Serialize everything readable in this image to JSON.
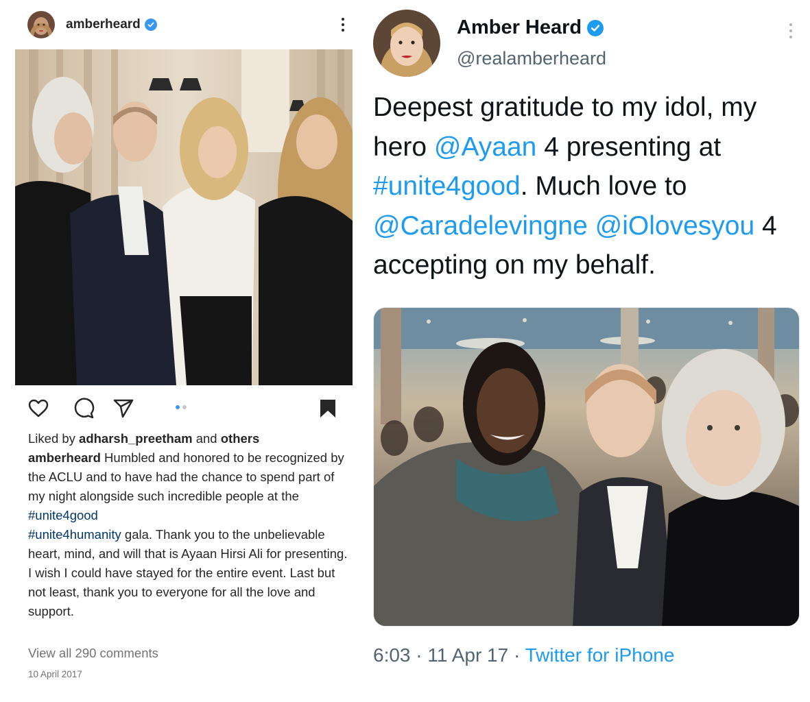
{
  "instagram": {
    "username": "amberheard",
    "liked_by_prefix": "Liked by ",
    "liked_by_user": "adharsh_preetham",
    "liked_by_suffix": " and ",
    "liked_by_others": "others",
    "caption_user": "amberheard",
    "caption_part1": " Humbled and honored to be recognized by the ACLU and to have had the chance to spend part of my night alongside such incredible people at the ",
    "hashtag1": "#unite4good",
    "hashtag2": "#unite4humanity",
    "caption_part2": " gala.  Thank you to the unbelievable heart, mind, and will that is Ayaan Hirsi Ali for presenting. I wish I could have stayed for the entire event. Last but not least, thank you to everyone for all the love and support.",
    "view_comments": "View all 290 comments",
    "date": "10 April 2017",
    "carousel": {
      "count": 2,
      "active": 0,
      "active_color": "#3897f0",
      "inactive_color": "#c7c7c7"
    }
  },
  "twitter": {
    "name": "Amber Heard",
    "handle": "@realamberheard",
    "text_1": "Deepest gratitude to my idol, my hero ",
    "mention_1": "@Ayaan",
    "text_2": " 4 presenting at ",
    "hashtag_1": "#unite4good",
    "text_3": ". Much love to ",
    "mention_2": "@Caradelevingne",
    "text_4": " ",
    "mention_3": "@iOlovesyou",
    "text_5": " 4 accepting on my behalf.",
    "time": "6:03",
    "separator": " · ",
    "date": "11 Apr 17",
    "source": "Twitter for iPhone"
  },
  "icons": {
    "ig_verified": "verified-badge-icon",
    "ig_more": "more-options-icon",
    "like": "heart-icon",
    "comment": "comment-bubble-icon",
    "share": "paper-plane-icon",
    "save": "bookmark-icon",
    "tw_verified": "verified-badge-icon",
    "tw_more": "more-options-icon"
  },
  "colors": {
    "ig_link": "#00376b",
    "twitter_blue": "#1d9bf0",
    "muted": "#737373"
  }
}
